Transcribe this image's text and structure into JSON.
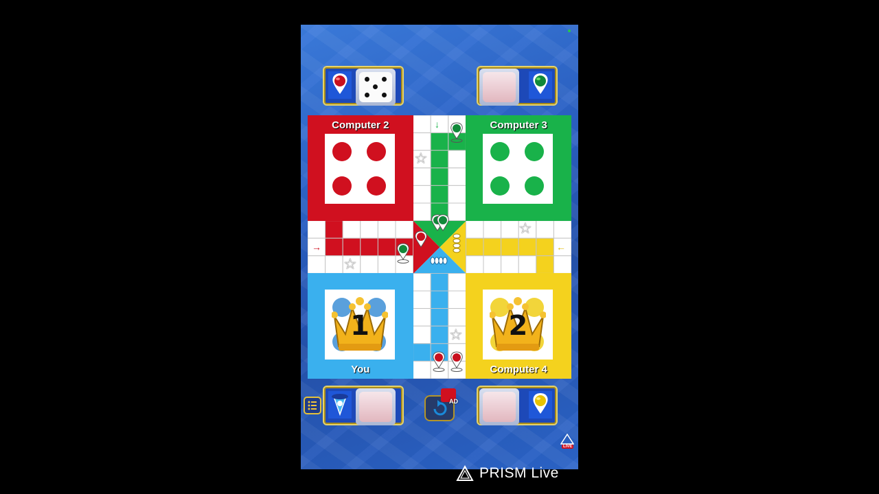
{
  "players": {
    "top_left": {
      "name": "Computer 2",
      "color": "#d0101f"
    },
    "top_right": {
      "name": "Computer 3",
      "color": "#19b24a"
    },
    "bottom_left": {
      "name": "You",
      "color": "#3ab0ee",
      "rank": "1"
    },
    "bottom_right": {
      "name": "Computer 4",
      "color": "#f4d21e",
      "rank": "2"
    }
  },
  "dice": {
    "top_left_value": 5
  },
  "icons": {
    "menu": "menu-list-icon",
    "undo": "undo-ad-icon",
    "ad_badge": "AD",
    "live_badge": "LIVE"
  },
  "watermark": {
    "text": "PRISM Live"
  }
}
